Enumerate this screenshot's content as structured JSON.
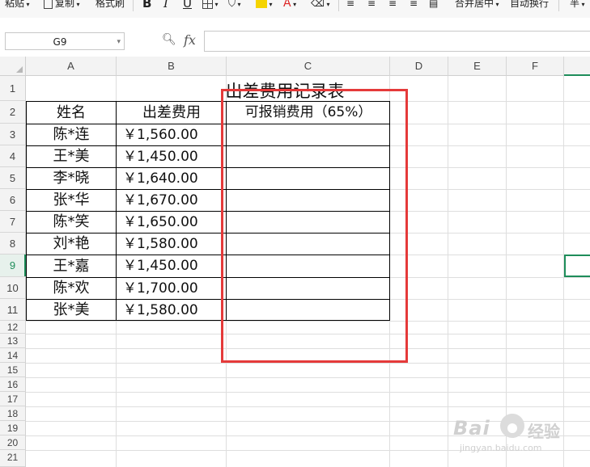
{
  "toolbar": {
    "paste": "粘贴",
    "copy": "复制",
    "format_painter": "格式刷",
    "bold": "B",
    "italic": "I",
    "underline": "U",
    "font_color": "A",
    "merge_center": "合并居中",
    "wrap_text": "自动换行",
    "number_format": "半"
  },
  "formula_bar": {
    "name_box": "G9",
    "fx_label": "fx",
    "formula_value": ""
  },
  "columns": [
    "A",
    "B",
    "C",
    "D",
    "E",
    "F"
  ],
  "rows": [
    "1",
    "2",
    "3",
    "4",
    "5",
    "6",
    "7",
    "8",
    "9",
    "10",
    "11",
    "12",
    "13",
    "14",
    "15",
    "16",
    "17",
    "18",
    "19",
    "20",
    "21"
  ],
  "sheet": {
    "title": "出差费用记录表",
    "headers": [
      "姓名",
      "出差费用",
      "可报销费用（65%）"
    ],
    "records": [
      {
        "name": "陈*连",
        "cost": "￥1,560.00",
        "reimbursable": ""
      },
      {
        "name": "王*美",
        "cost": "￥1,450.00",
        "reimbursable": ""
      },
      {
        "name": "李*晓",
        "cost": "￥1,640.00",
        "reimbursable": ""
      },
      {
        "name": "张*华",
        "cost": "￥1,670.00",
        "reimbursable": ""
      },
      {
        "name": "陈*笑",
        "cost": "￥1,650.00",
        "reimbursable": ""
      },
      {
        "name": "刘*艳",
        "cost": "￥1,580.00",
        "reimbursable": ""
      },
      {
        "name": "王*嘉",
        "cost": "￥1,450.00",
        "reimbursable": ""
      },
      {
        "name": "陈*欢",
        "cost": "￥1,700.00",
        "reimbursable": ""
      },
      {
        "name": "张*美",
        "cost": "￥1,580.00",
        "reimbursable": ""
      }
    ]
  },
  "selection": {
    "active_row": "9"
  },
  "watermark": {
    "brand": "Bai",
    "brand2": "经验",
    "url": "jingyan.baidu.com"
  },
  "colors": {
    "accent": "#1e8d5a",
    "annotation": "#e53a3a"
  }
}
